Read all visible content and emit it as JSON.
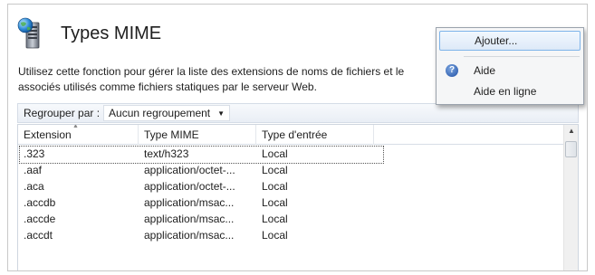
{
  "page": {
    "title": "Types MIME",
    "description_line1": "Utilisez cette fonction pour gérer la liste des extensions de noms de fichiers et le",
    "description_line2": "associés utilisés comme fichiers statiques par le serveur Web."
  },
  "toolbar": {
    "group_label": "Regrouper par :",
    "group_value": "Aucun regroupement"
  },
  "grid": {
    "columns": [
      "Extension",
      "Type MIME",
      "Type d'entrée"
    ],
    "rows": [
      {
        "ext": ".323",
        "mime": "text/h323",
        "entry": "Local"
      },
      {
        "ext": ".aaf",
        "mime": "application/octet-...",
        "entry": "Local"
      },
      {
        "ext": ".aca",
        "mime": "application/octet-...",
        "entry": "Local"
      },
      {
        "ext": ".accdb",
        "mime": "application/msac...",
        "entry": "Local"
      },
      {
        "ext": ".accde",
        "mime": "application/msac...",
        "entry": "Local"
      },
      {
        "ext": ".accdt",
        "mime": "application/msac...",
        "entry": "Local"
      }
    ]
  },
  "context_menu": {
    "items": [
      "Ajouter...",
      "Aide",
      "Aide en ligne"
    ]
  },
  "colors": {
    "menu_hover_border": "#7eb4ea",
    "help_icon": "#1f4fa4"
  }
}
